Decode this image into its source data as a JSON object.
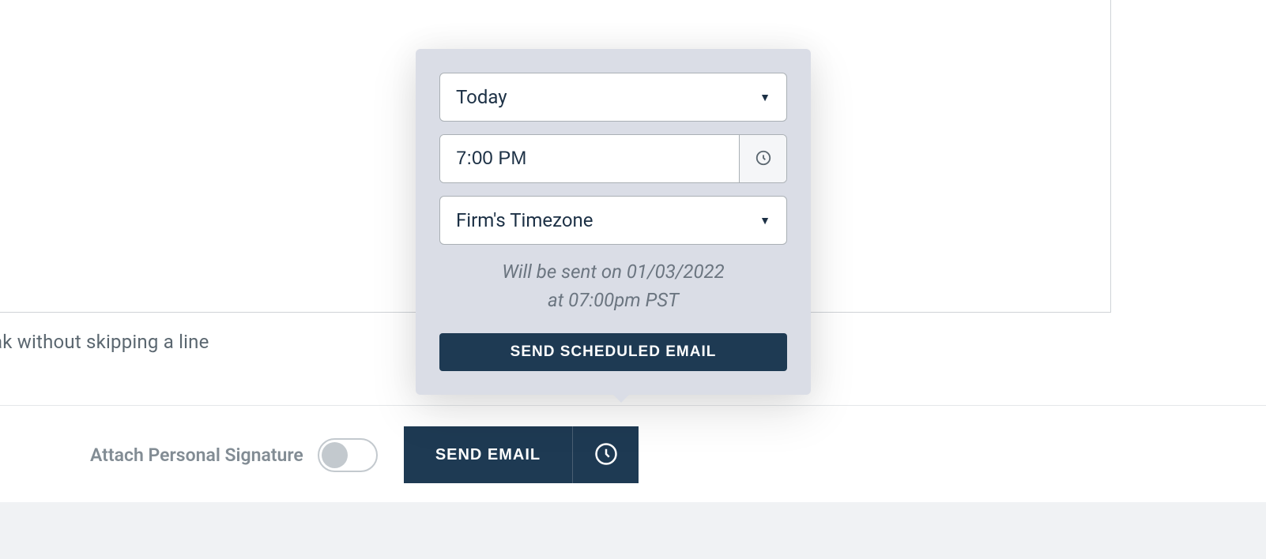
{
  "editor": {
    "hint_fragment": "ak without skipping a line"
  },
  "footer": {
    "signature_label": "Attach Personal Signature",
    "signature_on": false,
    "send_label": "SEND EMAIL"
  },
  "schedule": {
    "date_option": "Today",
    "time_value": "7:00 PM",
    "timezone_option": "Firm's Timezone",
    "info_line1": "Will be sent on 01/03/2022",
    "info_line2": "at 07:00pm PST",
    "send_scheduled_label": "SEND SCHEDULED EMAIL"
  }
}
